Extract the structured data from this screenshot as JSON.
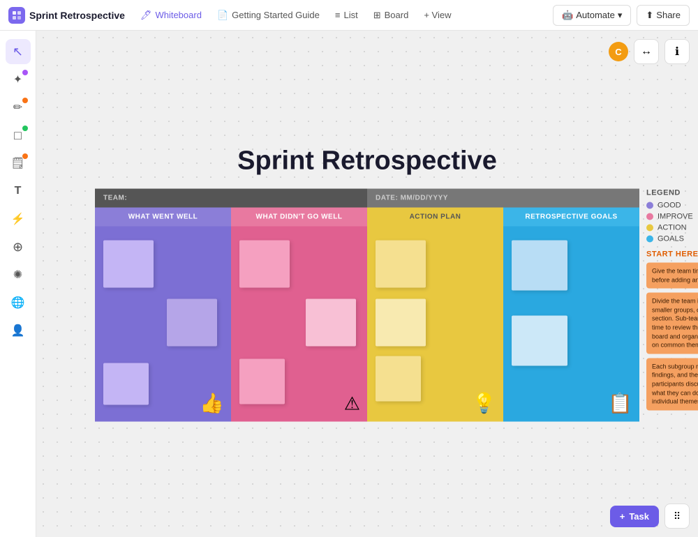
{
  "app": {
    "logo_text": "Sprint Retrospective",
    "logo_icon": "◈"
  },
  "nav": {
    "tabs": [
      {
        "id": "whiteboard",
        "label": "Whiteboard",
        "icon": "🖊",
        "active": true
      },
      {
        "id": "getting-started",
        "label": "Getting Started Guide",
        "icon": "📄",
        "active": false
      },
      {
        "id": "list",
        "label": "List",
        "icon": "≡",
        "active": false
      },
      {
        "id": "board",
        "label": "Board",
        "icon": "⬜",
        "active": false
      },
      {
        "id": "view",
        "label": "+ View",
        "icon": "",
        "active": false
      }
    ],
    "automate_label": "Automate",
    "share_label": "Share",
    "avatar_letter": "C"
  },
  "sidebar": {
    "tools": [
      {
        "id": "cursor",
        "icon": "↖",
        "active": true,
        "dot": null
      },
      {
        "id": "magic",
        "icon": "✦",
        "active": false,
        "dot": "purple"
      },
      {
        "id": "pen",
        "icon": "✏",
        "active": false,
        "dot": "orange"
      },
      {
        "id": "shape",
        "icon": "□",
        "active": false,
        "dot": "green"
      },
      {
        "id": "note",
        "icon": "🗒",
        "active": false,
        "dot": "orange"
      },
      {
        "id": "text",
        "icon": "T",
        "active": false,
        "dot": null
      },
      {
        "id": "spark",
        "icon": "✦",
        "active": false,
        "dot": null
      },
      {
        "id": "connections",
        "icon": "⊕",
        "active": false,
        "dot": null
      },
      {
        "id": "integration",
        "icon": "✺",
        "active": false,
        "dot": null
      },
      {
        "id": "globe",
        "icon": "🌐",
        "active": false,
        "dot": null
      },
      {
        "id": "person",
        "icon": "👤",
        "active": false,
        "dot": null
      }
    ]
  },
  "board": {
    "title": "Sprint Retrospective",
    "team_label": "TEAM:",
    "date_label": "DATE: MM/DD/YYYY",
    "columns": [
      {
        "id": "went-well",
        "label": "WHAT WENT WELL",
        "icon": "👍"
      },
      {
        "id": "didnt-go",
        "label": "WHAT DIDN'T GO WELL",
        "icon": "⚠"
      },
      {
        "id": "action",
        "label": "ACTION PLAN",
        "icon": "💡"
      },
      {
        "id": "retro-goals",
        "label": "RETROSPECTIVE GOALS",
        "icon": "📋"
      }
    ]
  },
  "legend": {
    "title": "LEGEND",
    "items": [
      {
        "label": "GOOD",
        "color": "#8b7ed8"
      },
      {
        "label": "IMPROVE",
        "color": "#e879a0"
      },
      {
        "label": "ACTION",
        "color": "#e8c840"
      },
      {
        "label": "GOALS",
        "color": "#3bb5e8"
      }
    ],
    "start_here": "START HERE!",
    "instructions": [
      "Give the team time to reflect before adding any notes.",
      "Divide the team into four smaller groups, one for each section. Sub-teams will be given time to review the notes on their board and organize them based on common themes.",
      "Each subgroup reports on their findings, and then all participants discuss together what they can do to address the individual themes."
    ]
  },
  "toolbar": {
    "fit_icon": "↔",
    "info_icon": "ℹ"
  },
  "bottom_right": {
    "task_label": "Task",
    "task_icon": "+"
  }
}
